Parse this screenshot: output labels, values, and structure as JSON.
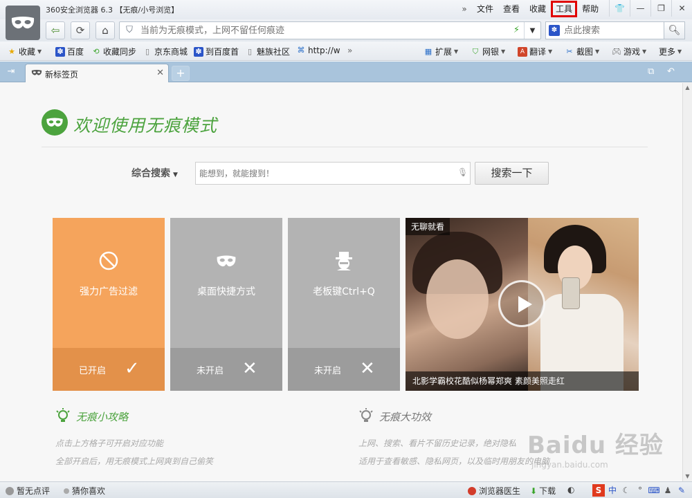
{
  "window": {
    "title": "360安全浏览器 6.3 【无痕/小号浏览】",
    "menu": [
      "文件",
      "查看",
      "收藏",
      "工具",
      "帮助"
    ]
  },
  "nav": {
    "address_placeholder": "当前为无痕模式，上网不留任何痕迹",
    "search_placeholder": "点此搜索"
  },
  "bookmarks": {
    "left": [
      {
        "label": "收藏",
        "icon": "star-icon"
      },
      {
        "label": "百度",
        "icon": "baidu-paw-icon"
      },
      {
        "label": "收藏同步",
        "icon": "sync-icon"
      },
      {
        "label": "京东商城",
        "icon": "page-icon"
      },
      {
        "label": "到百度首",
        "icon": "baidu-paw-icon"
      },
      {
        "label": "魅族社区",
        "icon": "page-icon"
      },
      {
        "label": "http://w",
        "icon": "link-icon"
      }
    ],
    "right": [
      {
        "label": "扩展",
        "icon": "grid-icon"
      },
      {
        "label": "网银",
        "icon": "shield-icon"
      },
      {
        "label": "翻译",
        "icon": "translate-icon"
      },
      {
        "label": "截图",
        "icon": "screenshot-icon"
      },
      {
        "label": "游戏",
        "icon": "gamepad-icon"
      },
      {
        "label": "更多",
        "icon": "more-icon"
      }
    ]
  },
  "tab": {
    "label": "新标签页"
  },
  "page": {
    "welcome": "欢迎使用无痕模式",
    "search_type": "综合搜索",
    "search_placeholder": "能想到，就能搜到！",
    "search_button": "搜索一下",
    "tiles": [
      {
        "label": "强力广告过滤",
        "state": "已开启",
        "enabled": true,
        "icon": "block-icon"
      },
      {
        "label": "桌面快捷方式",
        "state": "未开启",
        "enabled": false,
        "icon": "mask-icon"
      },
      {
        "label": "老板键Ctrl+Q",
        "state": "未开启",
        "enabled": false,
        "icon": "boss-icon"
      }
    ],
    "video": {
      "tag": "无聊就看",
      "caption": "北影学霸校花酷似杨幂郑爽 素颜美照走红"
    },
    "tips_left": {
      "title": "无痕小攻略",
      "lines": [
        "点击上方格子可开启对应功能",
        "全部开启后，用无痕模式上网爽到自己偷笑"
      ]
    },
    "tips_right": {
      "title": "无痕大功效",
      "lines": [
        "上网、搜索、看片不留历史记录，绝对隐私",
        "适用于查看敏感、隐私网页，以及临时用朋友的电脑"
      ]
    }
  },
  "watermark": {
    "text": "Baidu 经验",
    "sub": "jingyan.baidu.com"
  },
  "status": {
    "left": [
      "暂无点评",
      "猜你喜欢"
    ],
    "right": [
      "浏览器医生",
      "下载"
    ]
  },
  "colors": {
    "accent_green": "#4ca33e",
    "tile_on": "#f5a45c",
    "tile_off": "#b3b3b3",
    "highlight_red": "#e00000"
  }
}
